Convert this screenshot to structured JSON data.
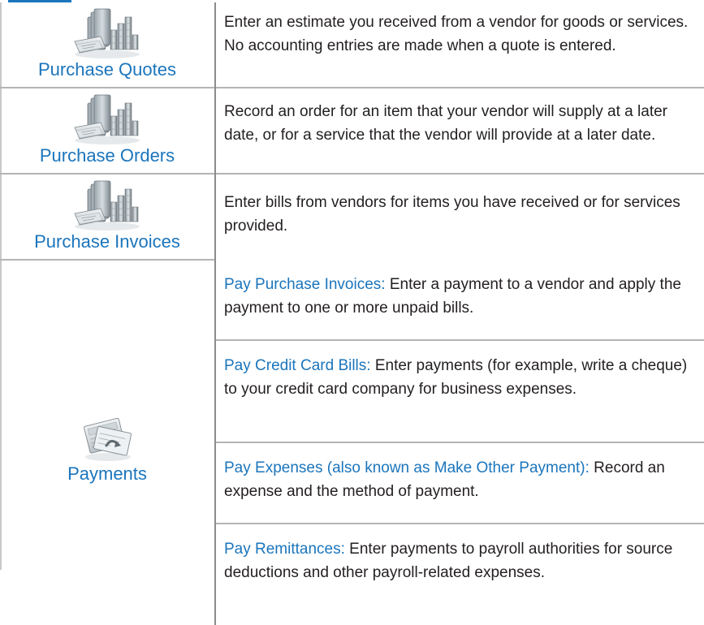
{
  "rows": [
    {
      "label": "Purchase Quotes",
      "icon": "purchase-documents-icon",
      "description": "Enter an estimate you received from a vendor for goods or services. No accounting entries are made when a quote is entered."
    },
    {
      "label": "Purchase Orders",
      "icon": "purchase-documents-icon",
      "description": "Record an order for an item that your vendor will supply at a later date, or for a service that the vendor will provide at a later date."
    },
    {
      "label": "Purchase Invoices",
      "icon": "purchase-documents-icon",
      "description": "Enter bills from vendors for items you have received or for services provided."
    }
  ],
  "payments": {
    "label": "Payments",
    "icon": "payments-cheque-icon",
    "items": [
      {
        "title": "Pay Purchase Invoices:",
        "text": " Enter a payment to a vendor and apply the payment to one or more unpaid bills."
      },
      {
        "title": "Pay Credit Card Bills:",
        "text": " Enter payments (for example, write a cheque) to your credit card company for business expenses."
      },
      {
        "title": "Pay Expenses (also known as Make Other Payment):",
        "text": " Record an expense and the method of payment."
      },
      {
        "title": "Pay Remittances:",
        "text": " Enter payments to payroll authorities for source deductions and other payroll-related expenses."
      }
    ]
  },
  "colors": {
    "accent": "#1b75bc",
    "text": "#231f20",
    "rule": "#b4b4b4"
  }
}
